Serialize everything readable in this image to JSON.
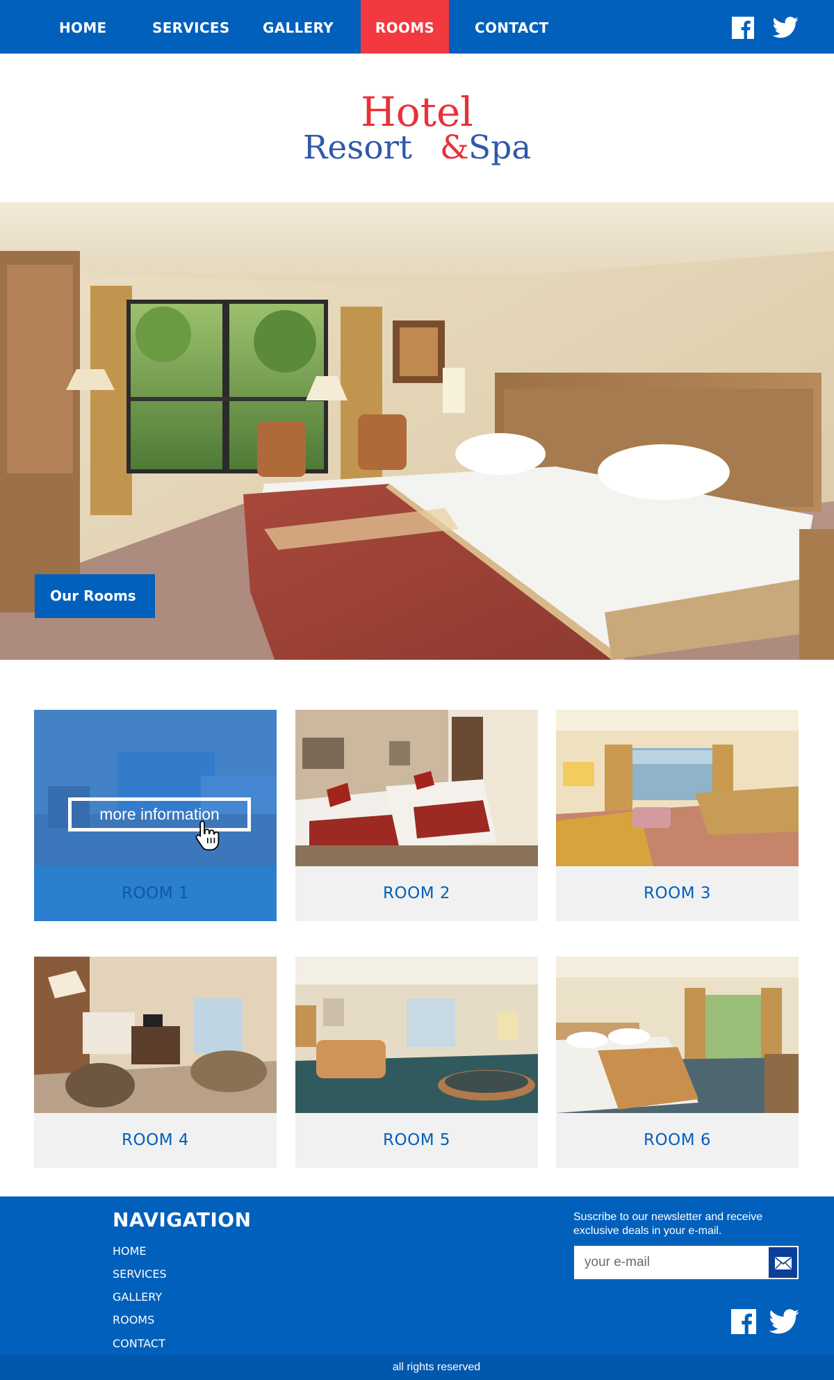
{
  "nav": {
    "items": [
      "HOME",
      "SERVICES",
      "GALLERY",
      "ROOMS",
      "CONTACT"
    ],
    "active": "ROOMS",
    "active_color": "#f2393f"
  },
  "brand": {
    "line1": "Hotel",
    "line2_a": "Resort",
    "ampersand": "&",
    "line2_b": "Spa",
    "color_red": "#e8313a",
    "color_blue": "#2f59a8"
  },
  "hero": {
    "badge": "Our Rooms"
  },
  "rooms": {
    "more_info": "more information",
    "items": [
      {
        "label": "ROOM 1"
      },
      {
        "label": "ROOM 2"
      },
      {
        "label": "ROOM 3"
      },
      {
        "label": "ROOM 4"
      },
      {
        "label": "ROOM 5"
      },
      {
        "label": "ROOM 6"
      }
    ]
  },
  "footer": {
    "nav_title": "NAVIGATION",
    "links": [
      "HOME",
      "SERVICES",
      "GALLERY",
      "ROOMS",
      "CONTACT"
    ],
    "newsletter_text": "Suscribe to our newsletter and receive exclusive deals in your e-mail.",
    "email_placeholder": "your e-mail",
    "copyright": "all rights reserved"
  },
  "icons": {
    "social": [
      "facebook-icon",
      "twitter-icon"
    ],
    "submit": "envelope-icon",
    "pointer": "hand-cursor-icon"
  },
  "colors": {
    "primary": "#0060bb",
    "accent": "#f2393f",
    "card_bg": "#f1f1f1"
  }
}
